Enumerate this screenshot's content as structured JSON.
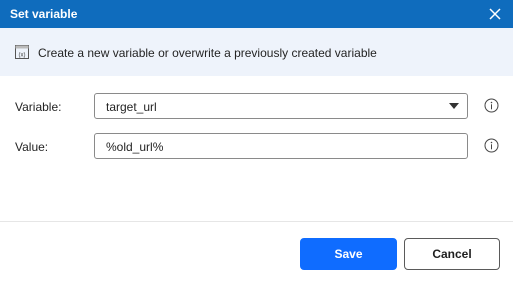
{
  "dialog": {
    "title": "Set variable",
    "info_text": "Create a new variable or overwrite a previously created variable"
  },
  "form": {
    "variable_label": "Variable:",
    "variable_value": "target_url",
    "value_label": "Value:",
    "value_value": "%old_url%"
  },
  "buttons": {
    "save_label": "Save",
    "cancel_label": "Cancel"
  },
  "icons": {
    "close": "close-icon",
    "info": "variable-icon",
    "dropdown": "chevron-down-icon",
    "help": "info-circle-icon"
  },
  "colors": {
    "titlebar": "#0f6cbd",
    "infobar": "#eef3fb",
    "primary_button": "#0f6cff"
  }
}
